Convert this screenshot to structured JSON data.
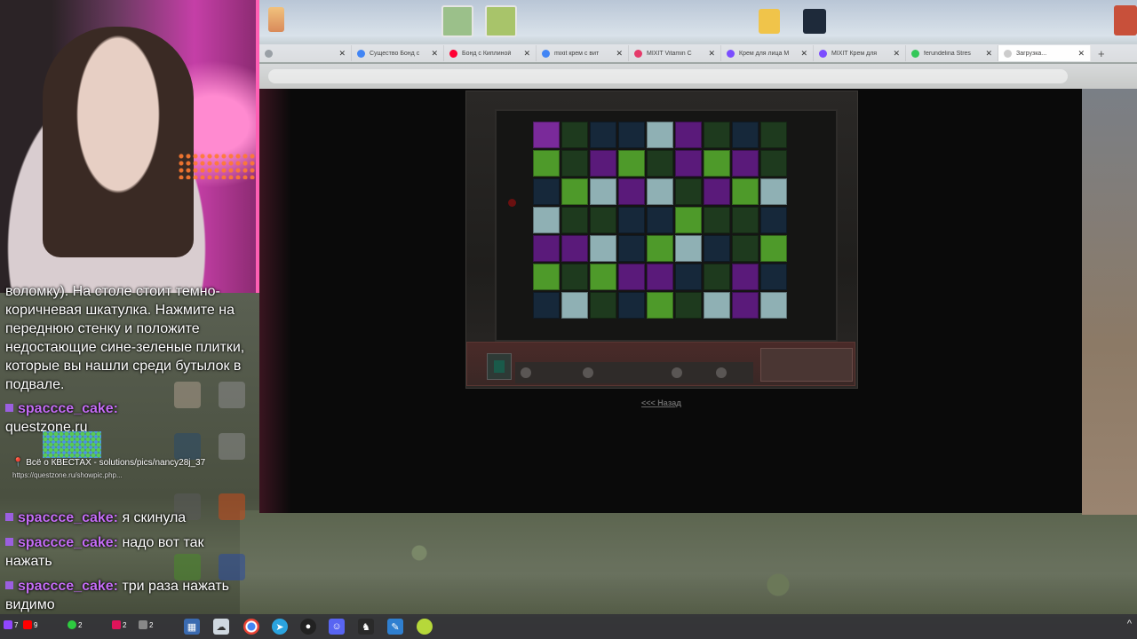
{
  "browser": {
    "tabs": [
      {
        "label": "",
        "favicon": "#9aa0a6"
      },
      {
        "label": "Существо Бонд с",
        "favicon": "#4285f4"
      },
      {
        "label": "Бонд с Киплиной",
        "favicon": "#ff0033"
      },
      {
        "label": "mixit крем с вит",
        "favicon": "#4285f4"
      },
      {
        "label": "MIXIT Vitamin C",
        "favicon": "#e53a6a"
      },
      {
        "label": "Крем для лица M",
        "favicon": "#7b4dff"
      },
      {
        "label": "MIXIT Крем для",
        "favicon": "#7b4dff"
      },
      {
        "label": "ferundelina Stres",
        "favicon": "#34c759"
      },
      {
        "label": "Загрузка...",
        "favicon": "#cccccc",
        "active": true
      }
    ],
    "new_tab_symbol": "+",
    "close_symbol": "✕"
  },
  "game": {
    "back_link": "<<< Назад",
    "grid_colors": [
      [
        "#7a2a9a",
        "#1e3a1e",
        "#16283a",
        "#16283a",
        "#8fb0b4",
        "#5a1a7a",
        "#1e3a1e",
        "#16283a",
        "#1e3a1e"
      ],
      [
        "#4e9a2a",
        "#1e3a1e",
        "#5a1a7a",
        "#4e9a2a",
        "#1e3a1e",
        "#5a1a7a",
        "#4e9a2a",
        "#5a1a7a",
        "#1e3a1e"
      ],
      [
        "#16283a",
        "#4e9a2a",
        "#8fb0b4",
        "#5a1a7a",
        "#8fb0b4",
        "#1e3a1e",
        "#5a1a7a",
        "#4e9a2a",
        "#8fb0b4"
      ],
      [
        "#8fb0b4",
        "#1e3a1e",
        "#1e3a1e",
        "#16283a",
        "#16283a",
        "#4e9a2a",
        "#1e3a1e",
        "#1e3a1e",
        "#16283a"
      ],
      [
        "#5a1a7a",
        "#5a1a7a",
        "#8fb0b4",
        "#16283a",
        "#4e9a2a",
        "#8fb0b4",
        "#16283a",
        "#1e3a1e",
        "#4e9a2a"
      ],
      [
        "#4e9a2a",
        "#1e3a1e",
        "#4e9a2a",
        "#5a1a7a",
        "#5a1a7a",
        "#16283a",
        "#1e3a1e",
        "#5a1a7a",
        "#16283a"
      ],
      [
        "#16283a",
        "#8fb0b4",
        "#1e3a1e",
        "#16283a",
        "#4e9a2a",
        "#1e3a1e",
        "#8fb0b4",
        "#5a1a7a",
        "#8fb0b4"
      ]
    ]
  },
  "chat": {
    "first_block": "воломку). На столе стоит темно-коричневая шкатулка. Нажмите на переднюю стенку и положите недостающие сине-зеленые плитки, которые вы нашли среди бутылок в подвале.",
    "messages": [
      {
        "user": "spaccce_cake:",
        "text": "questzone.ru"
      },
      {
        "user": "spaccce_cake:",
        "text": "я скинула"
      },
      {
        "user": "spaccce_cake:",
        "text": "надо вот так нажать"
      },
      {
        "user": "spaccce_cake:",
        "text": "три раза нажать видимо"
      }
    ],
    "preview": {
      "title": "Всё о КВЕСТАХ - solutions/pics/nancy28j_37",
      "url": "https://questzone.ru/showpic.php..."
    },
    "colors": {
      "username": "#c46cf5",
      "badge": "#9b5fe0"
    }
  },
  "taskbar": {
    "tray_arrow": "^",
    "status_counts": [
      "7",
      "9",
      "2",
      "2",
      "2"
    ]
  }
}
